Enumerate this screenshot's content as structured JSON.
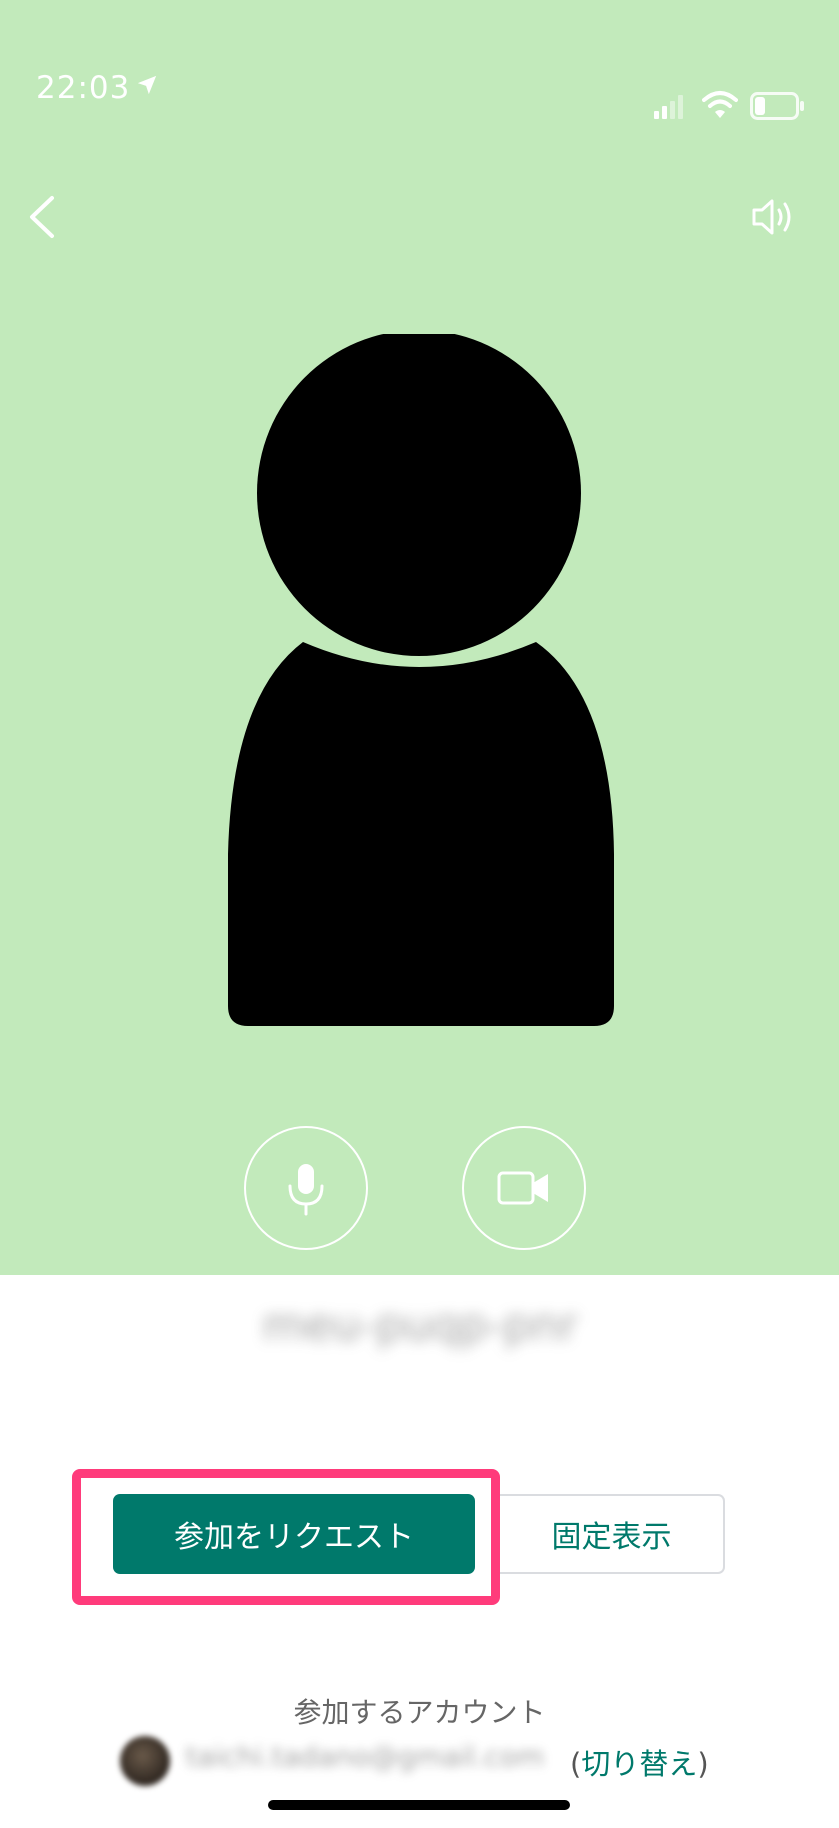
{
  "status_bar": {
    "time": "22:03",
    "icons": [
      "location-arrow-icon",
      "cellular-signal-icon",
      "wifi-icon",
      "battery-icon"
    ]
  },
  "preview": {
    "background_color": "#c2eabb",
    "back_icon": "chevron-left-icon",
    "speaker_icon": "speaker-icon",
    "mic_icon": "microphone-icon",
    "camera_icon": "video-camera-icon"
  },
  "meeting": {
    "code": "meu-puqp-pnr"
  },
  "actions": {
    "request_join_label": "参加をリクエスト",
    "pin_label": "固定表示",
    "accent_color": "#00796b",
    "highlight_color": "#ff3b7b"
  },
  "account": {
    "label": "参加するアカウント",
    "email": "taichi.tadano@gmail.com",
    "switch_open": "(",
    "switch_label": "切り替え",
    "switch_close": ")"
  }
}
